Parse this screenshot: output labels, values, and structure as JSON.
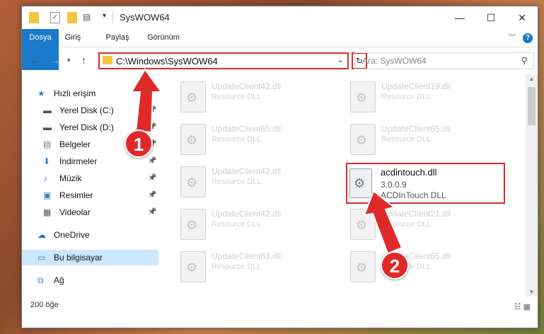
{
  "window": {
    "title": "SysWOW64"
  },
  "ribbon": {
    "tabs": [
      "Dosya",
      "Giriş",
      "Paylaş",
      "Görünüm"
    ]
  },
  "address": {
    "path": "C:\\Windows\\SysWOW64"
  },
  "search": {
    "placeholder": "Ara: SysWOW64"
  },
  "sidebar": {
    "items": [
      {
        "label": "Hızlı erişim",
        "icon": "star-icon",
        "pinned": false
      },
      {
        "label": "Yerel Disk (C:)",
        "icon": "drive-icon",
        "pinned": true
      },
      {
        "label": "Yerel Disk (D:)",
        "icon": "drive-icon",
        "pinned": true
      },
      {
        "label": "Belgeler",
        "icon": "documents-icon",
        "pinned": true
      },
      {
        "label": "İndirmeler",
        "icon": "download-icon",
        "pinned": true
      },
      {
        "label": "Müzik",
        "icon": "music-icon",
        "pinned": true
      },
      {
        "label": "Resimler",
        "icon": "pictures-icon",
        "pinned": true
      },
      {
        "label": "Videolar",
        "icon": "videos-icon",
        "pinned": true
      },
      {
        "label": "OneDrive",
        "icon": "cloud-icon",
        "pinned": false
      },
      {
        "label": "Bu bilgisayar",
        "icon": "computer-icon",
        "pinned": false,
        "selected": true
      },
      {
        "label": "Ağ",
        "icon": "network-icon",
        "pinned": false
      }
    ]
  },
  "files": [
    {
      "name": "UpdateClient42.dll",
      "desc": "Resource DLL"
    },
    {
      "name": "UpdateClient19.dll",
      "desc": "Resource DLL"
    },
    {
      "name": "UpdateClient65.dll",
      "desc": "Resource DLL"
    },
    {
      "name": "UpdateClient65.dll",
      "desc": "Resource DLL"
    },
    {
      "name": "UpdateClient42.dll",
      "desc": "Resource DLL"
    },
    {
      "name": "UpdateClient42.dll",
      "desc": "Resource DLL"
    },
    {
      "name": "UpdateClient21.dll",
      "desc": "Resource DLL"
    },
    {
      "name": "UpdateClient63.dll",
      "desc": "Resource DLL"
    },
    {
      "name": "UpdateClient65.dll",
      "desc": "Resource DLL"
    }
  ],
  "highlighted_file": {
    "name": "acdintouch.dll",
    "version": "3.0.0.9",
    "desc": "ACDInTouch DLL"
  },
  "status": {
    "count": "200 öğe"
  },
  "annotations": {
    "badge1": "1",
    "badge2": "2"
  },
  "colors": {
    "accent": "#1979ca",
    "highlight": "#e02a2a"
  }
}
